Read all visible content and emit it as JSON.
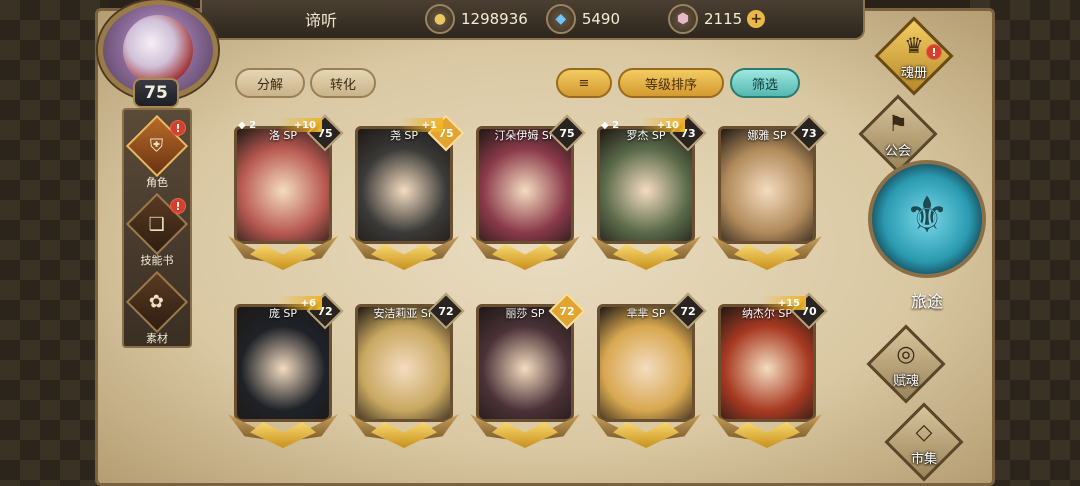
{
  "player": {
    "name": "谛听",
    "level": "75"
  },
  "resources": {
    "gold": {
      "icon": "gold-coin-icon",
      "value": "1298936"
    },
    "gem": {
      "icon": "blue-crystal-icon",
      "value": "5490"
    },
    "crystal": {
      "icon": "pink-crystal-icon",
      "value": "2115"
    },
    "plus": "+"
  },
  "left_nav": [
    {
      "label": "角色",
      "icon": "helmet-icon",
      "alert": "!"
    },
    {
      "label": "技能书",
      "icon": "book-icon",
      "alert": "!"
    },
    {
      "label": "素材",
      "icon": "material-icon"
    }
  ],
  "actions": {
    "decompose": "分解",
    "convert": "转化",
    "sort_icon": "sort-icon",
    "sort_level": "等级排序",
    "filter": "筛选"
  },
  "cards": [
    {
      "name": "洛 SP",
      "level": "75",
      "stars": "2",
      "plus": "+10",
      "color": "#b85a52"
    },
    {
      "name": "尧 SP",
      "level": "75",
      "plus": "+1",
      "gold_level": true,
      "color": "#3a3a38"
    },
    {
      "name": "汀朵伊姆 SP",
      "level": "75",
      "color": "#8a3a4a"
    },
    {
      "name": "罗杰 SP",
      "level": "73",
      "stars": "2",
      "plus": "+10",
      "color": "#5a6a4a"
    },
    {
      "name": "娜雅 SP",
      "level": "73",
      "color": "#b08a5a"
    },
    {
      "name": "庞 SP",
      "level": "72",
      "plus": "+6",
      "color": "#1e2228"
    },
    {
      "name": "安洁莉亚 SP",
      "level": "72",
      "color": "#c8a860"
    },
    {
      "name": "丽莎 SP",
      "level": "72",
      "gold_level": true,
      "color": "#4a3238"
    },
    {
      "name": "芈芈 SP",
      "level": "72",
      "color": "#d8a850"
    },
    {
      "name": "纳杰尔 SP",
      "level": "70",
      "plus": "+15",
      "color": "#a83a22"
    }
  ],
  "right_nav": [
    {
      "label": "魂册",
      "icon": "soul-book-icon",
      "alert": "!"
    },
    {
      "label": "公会",
      "icon": "guild-banner-icon"
    },
    {
      "label": "旅途",
      "icon": "journey-emblem-icon"
    },
    {
      "label": "赋魂",
      "icon": "swirl-icon"
    },
    {
      "label": "市集",
      "icon": "market-gem-icon"
    }
  ]
}
